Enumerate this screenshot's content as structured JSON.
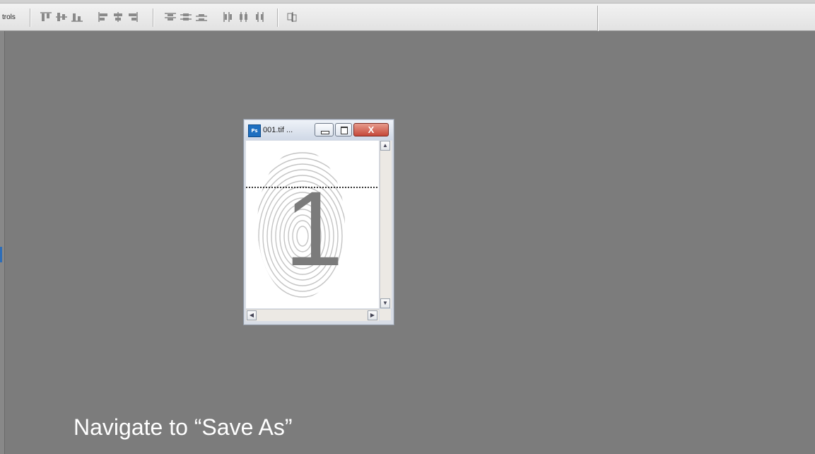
{
  "options_bar": {
    "label": "trols",
    "icons": [
      "align-top-edges-icon",
      "align-vertical-centers-icon",
      "align-bottom-edges-icon",
      "align-left-edges-icon",
      "align-horizontal-centers-icon",
      "align-right-edges-icon",
      "distribute-top-icon",
      "distribute-vertical-centers-icon",
      "distribute-bottom-icon",
      "distribute-left-icon",
      "distribute-horizontal-centers-icon",
      "distribute-right-icon",
      "auto-align-layers-icon"
    ]
  },
  "document_window": {
    "app_icon_text": "Ps",
    "title": "001.tif ...",
    "buttons": {
      "minimize": "",
      "maximize": "",
      "close": "X"
    },
    "image_digit": "1"
  },
  "caption": "Navigate to “Save As”",
  "colors": {
    "workspace_bg": "#7c7c7c",
    "toolbar_bg": "#e9e9e9",
    "close_button": "#c5483a",
    "ps_icon": "#1e6fc0"
  }
}
